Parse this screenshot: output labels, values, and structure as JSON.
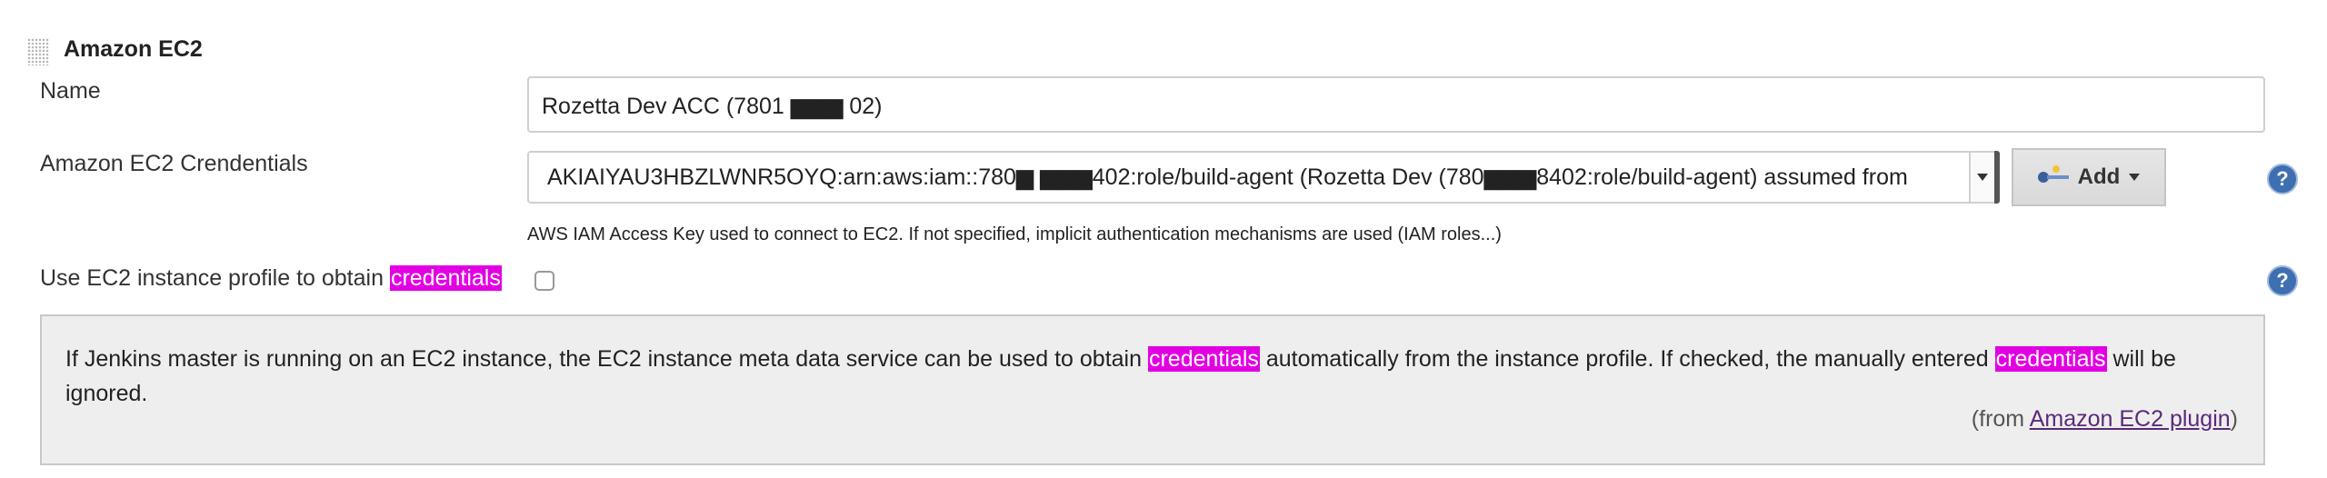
{
  "section": {
    "title": "Amazon EC2",
    "grip_icon": "drag-handle-icon"
  },
  "name_field": {
    "label": "Name",
    "value": "Rozetta Dev ACC (7801 ▆▆▆ 02)"
  },
  "credentials_field": {
    "label": "Amazon EC2 Crendentials",
    "selected_value": "AKIAIYAU3HBZLWNR5OYQ:arn:aws:iam::780▆ ▆▆▆402:role/build-agent (Rozetta Dev (780▆▆▆8402:role/build-agent) assumed from",
    "add_button_label": "Add",
    "help_icon": "help-icon",
    "description": "AWS IAM Access Key used to connect to EC2. If not specified, implicit authentication mechanisms are used (IAM roles...)"
  },
  "instance_profile": {
    "label_prefix": "Use EC2 instance profile to obtain ",
    "label_highlight": "credentials",
    "checked": false,
    "help_icon": "help-icon"
  },
  "help_panel": {
    "text_1": "If Jenkins master is running on an EC2 instance, the EC2 instance meta data service can be used to obtain ",
    "highlight_1": "credentials",
    "text_2": " automatically from the instance profile. If checked, the manually entered ",
    "highlight_2": "credentials",
    "text_3": " will be ignored.",
    "from_prefix": "(from ",
    "from_link": "Amazon EC2 plugin",
    "from_suffix": ")"
  },
  "colors": {
    "highlight": "#e200e2",
    "help_icon": "#3d6fb1",
    "panel_bg": "#eeeeee"
  }
}
